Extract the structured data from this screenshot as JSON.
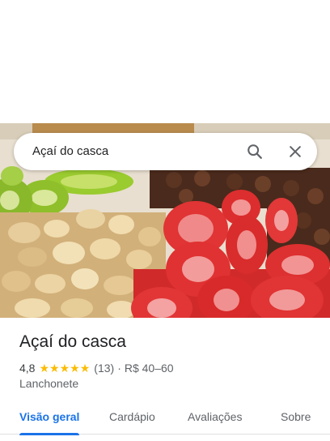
{
  "search": {
    "query": "Açaí do casca",
    "search_icon": "search-icon",
    "close_icon": "close-icon"
  },
  "photo": {
    "description_icon": "place-photo"
  },
  "place": {
    "name": "Açaí do casca",
    "rating": "4,8",
    "stars": 5,
    "reviews": "(13)",
    "separator": "·",
    "price": "R$ 40–60",
    "category": "Lanchonete"
  },
  "tabs": [
    {
      "label": "Visão geral",
      "active": true
    },
    {
      "label": "Cardápio",
      "active": false
    },
    {
      "label": "Avaliações",
      "active": false
    },
    {
      "label": "Sobre",
      "active": false
    }
  ],
  "colors": {
    "accent": "#1a73e8",
    "star": "#fbbc04",
    "text": "#202124",
    "secondary_text": "#5f6368"
  }
}
